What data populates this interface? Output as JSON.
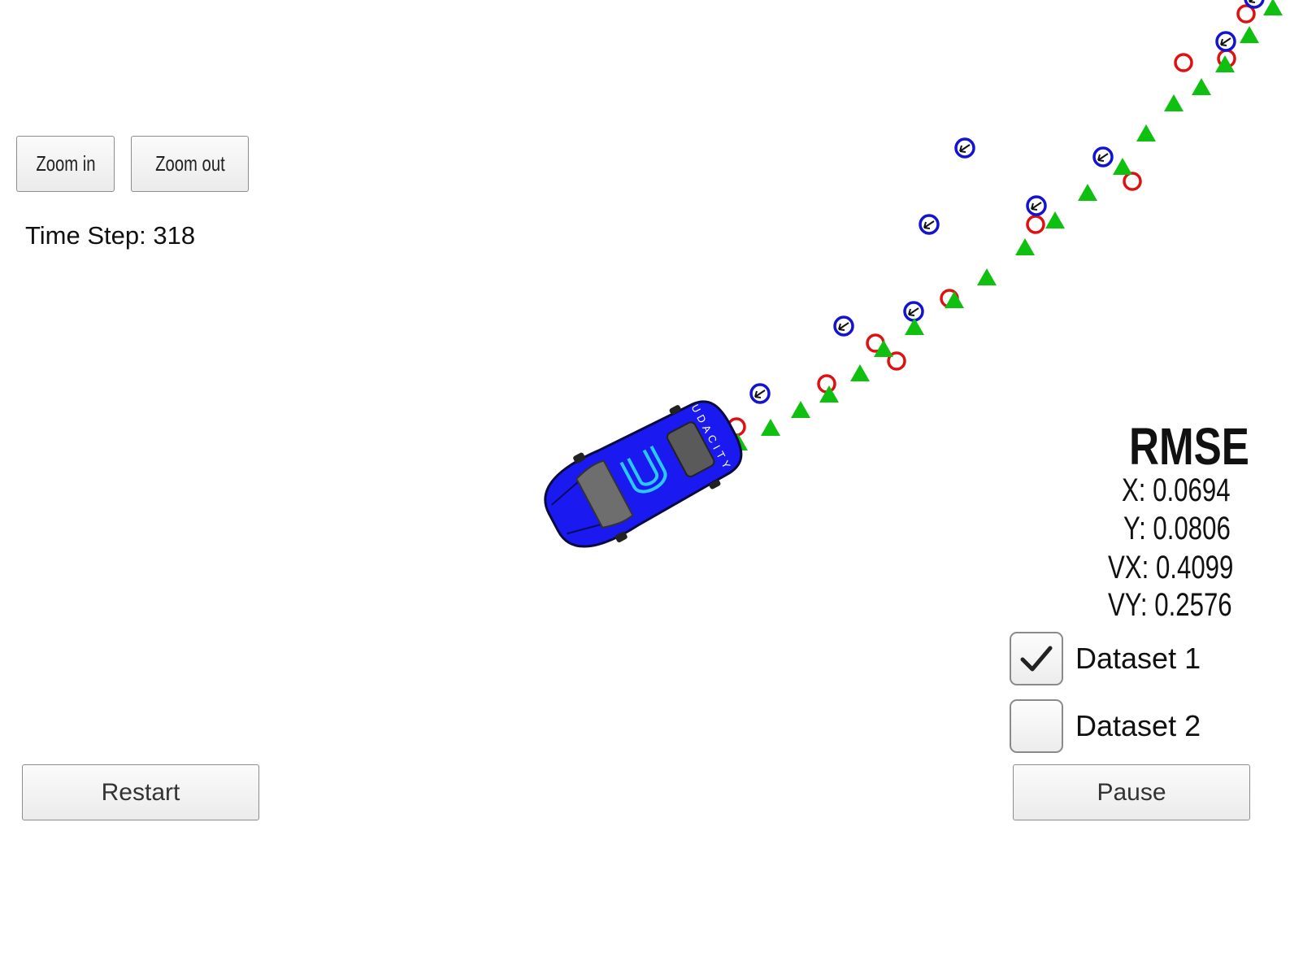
{
  "controls": {
    "zoom_in_label": "Zoom in",
    "zoom_out_label": "Zoom out",
    "restart_label": "Restart",
    "pause_label": "Pause"
  },
  "status": {
    "time_step_text": "Time Step: 318"
  },
  "rmse": {
    "title": "RMSE",
    "x_text": "X: 0.0694",
    "y_text": "Y: 0.0806",
    "vx_text": "VX: 0.4099",
    "vy_text": "VY: 0.2576"
  },
  "datasets": [
    {
      "label": "Dataset 1",
      "checked": true
    },
    {
      "label": "Dataset 2",
      "checked": false
    }
  ],
  "car": {
    "brand_text": "UDACITY",
    "color": "#1a1af0"
  },
  "marker_colors": {
    "lidar": "#e01010",
    "radar": "#1414d0",
    "estimate": "#10c010"
  }
}
